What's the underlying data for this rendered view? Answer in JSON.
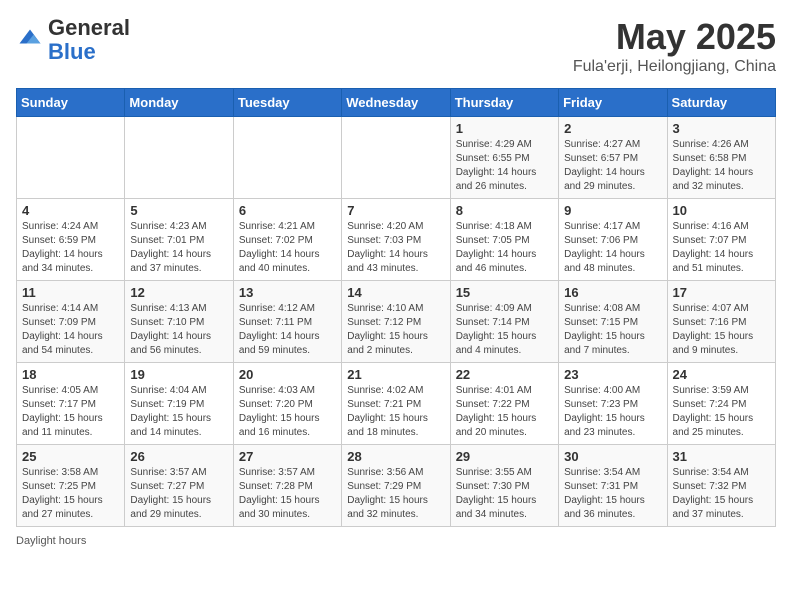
{
  "app": {
    "logo_general": "General",
    "logo_blue": "Blue"
  },
  "title": {
    "month": "May 2025",
    "location": "Fula'erji, Heilongjiang, China"
  },
  "headers": [
    "Sunday",
    "Monday",
    "Tuesday",
    "Wednesday",
    "Thursday",
    "Friday",
    "Saturday"
  ],
  "weeks": [
    [
      {
        "day": "",
        "info": ""
      },
      {
        "day": "",
        "info": ""
      },
      {
        "day": "",
        "info": ""
      },
      {
        "day": "",
        "info": ""
      },
      {
        "day": "1",
        "info": "Sunrise: 4:29 AM\nSunset: 6:55 PM\nDaylight: 14 hours and 26 minutes."
      },
      {
        "day": "2",
        "info": "Sunrise: 4:27 AM\nSunset: 6:57 PM\nDaylight: 14 hours and 29 minutes."
      },
      {
        "day": "3",
        "info": "Sunrise: 4:26 AM\nSunset: 6:58 PM\nDaylight: 14 hours and 32 minutes."
      }
    ],
    [
      {
        "day": "4",
        "info": "Sunrise: 4:24 AM\nSunset: 6:59 PM\nDaylight: 14 hours and 34 minutes."
      },
      {
        "day": "5",
        "info": "Sunrise: 4:23 AM\nSunset: 7:01 PM\nDaylight: 14 hours and 37 minutes."
      },
      {
        "day": "6",
        "info": "Sunrise: 4:21 AM\nSunset: 7:02 PM\nDaylight: 14 hours and 40 minutes."
      },
      {
        "day": "7",
        "info": "Sunrise: 4:20 AM\nSunset: 7:03 PM\nDaylight: 14 hours and 43 minutes."
      },
      {
        "day": "8",
        "info": "Sunrise: 4:18 AM\nSunset: 7:05 PM\nDaylight: 14 hours and 46 minutes."
      },
      {
        "day": "9",
        "info": "Sunrise: 4:17 AM\nSunset: 7:06 PM\nDaylight: 14 hours and 48 minutes."
      },
      {
        "day": "10",
        "info": "Sunrise: 4:16 AM\nSunset: 7:07 PM\nDaylight: 14 hours and 51 minutes."
      }
    ],
    [
      {
        "day": "11",
        "info": "Sunrise: 4:14 AM\nSunset: 7:09 PM\nDaylight: 14 hours and 54 minutes."
      },
      {
        "day": "12",
        "info": "Sunrise: 4:13 AM\nSunset: 7:10 PM\nDaylight: 14 hours and 56 minutes."
      },
      {
        "day": "13",
        "info": "Sunrise: 4:12 AM\nSunset: 7:11 PM\nDaylight: 14 hours and 59 minutes."
      },
      {
        "day": "14",
        "info": "Sunrise: 4:10 AM\nSunset: 7:12 PM\nDaylight: 15 hours and 2 minutes."
      },
      {
        "day": "15",
        "info": "Sunrise: 4:09 AM\nSunset: 7:14 PM\nDaylight: 15 hours and 4 minutes."
      },
      {
        "day": "16",
        "info": "Sunrise: 4:08 AM\nSunset: 7:15 PM\nDaylight: 15 hours and 7 minutes."
      },
      {
        "day": "17",
        "info": "Sunrise: 4:07 AM\nSunset: 7:16 PM\nDaylight: 15 hours and 9 minutes."
      }
    ],
    [
      {
        "day": "18",
        "info": "Sunrise: 4:05 AM\nSunset: 7:17 PM\nDaylight: 15 hours and 11 minutes."
      },
      {
        "day": "19",
        "info": "Sunrise: 4:04 AM\nSunset: 7:19 PM\nDaylight: 15 hours and 14 minutes."
      },
      {
        "day": "20",
        "info": "Sunrise: 4:03 AM\nSunset: 7:20 PM\nDaylight: 15 hours and 16 minutes."
      },
      {
        "day": "21",
        "info": "Sunrise: 4:02 AM\nSunset: 7:21 PM\nDaylight: 15 hours and 18 minutes."
      },
      {
        "day": "22",
        "info": "Sunrise: 4:01 AM\nSunset: 7:22 PM\nDaylight: 15 hours and 20 minutes."
      },
      {
        "day": "23",
        "info": "Sunrise: 4:00 AM\nSunset: 7:23 PM\nDaylight: 15 hours and 23 minutes."
      },
      {
        "day": "24",
        "info": "Sunrise: 3:59 AM\nSunset: 7:24 PM\nDaylight: 15 hours and 25 minutes."
      }
    ],
    [
      {
        "day": "25",
        "info": "Sunrise: 3:58 AM\nSunset: 7:25 PM\nDaylight: 15 hours and 27 minutes."
      },
      {
        "day": "26",
        "info": "Sunrise: 3:57 AM\nSunset: 7:27 PM\nDaylight: 15 hours and 29 minutes."
      },
      {
        "day": "27",
        "info": "Sunrise: 3:57 AM\nSunset: 7:28 PM\nDaylight: 15 hours and 30 minutes."
      },
      {
        "day": "28",
        "info": "Sunrise: 3:56 AM\nSunset: 7:29 PM\nDaylight: 15 hours and 32 minutes."
      },
      {
        "day": "29",
        "info": "Sunrise: 3:55 AM\nSunset: 7:30 PM\nDaylight: 15 hours and 34 minutes."
      },
      {
        "day": "30",
        "info": "Sunrise: 3:54 AM\nSunset: 7:31 PM\nDaylight: 15 hours and 36 minutes."
      },
      {
        "day": "31",
        "info": "Sunrise: 3:54 AM\nSunset: 7:32 PM\nDaylight: 15 hours and 37 minutes."
      }
    ]
  ],
  "footer": {
    "text": "Daylight hours"
  }
}
